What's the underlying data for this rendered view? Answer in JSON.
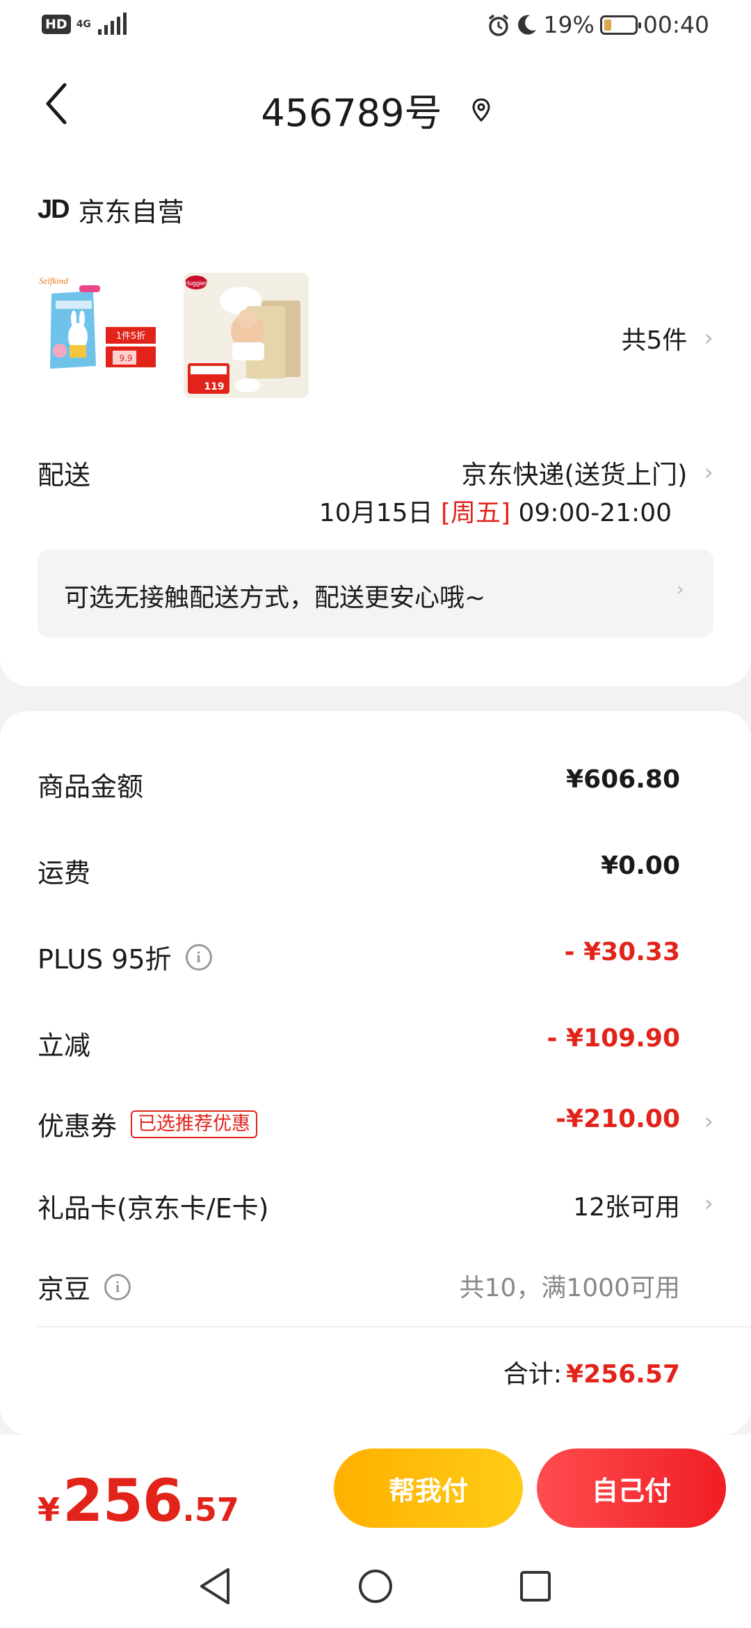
{
  "status_bar": {
    "hd": "HD",
    "network": "4G",
    "battery": "19%",
    "time": "00:40"
  },
  "nav": {
    "title": "456789号"
  },
  "shop": {
    "logo": "JD",
    "name": "京东自营"
  },
  "products": {
    "count_label": "共5件",
    "item1": {
      "tag": "1件5折",
      "price": "9.9"
    },
    "item2": {
      "price": "119"
    }
  },
  "delivery": {
    "label": "配送",
    "method": "京东快递(送货上门)",
    "date": "10月15日",
    "weekday": "[周五]",
    "time": "09:00-21:00",
    "notice": "可选无接触配送方式，配送更安心哦~"
  },
  "summary": {
    "rows": [
      {
        "label": "商品金额",
        "value": "¥606.80"
      },
      {
        "label": "运费",
        "value": "¥0.00"
      },
      {
        "label": "PLUS 95折",
        "value": "- ¥30.33"
      },
      {
        "label": "立减",
        "value": "- ¥109.90"
      },
      {
        "label": "优惠券",
        "tag": "已选推荐优惠",
        "value": "-¥210.00"
      },
      {
        "label": "礼品卡(京东卡/E卡)",
        "value": "12张可用"
      },
      {
        "label": "京豆",
        "value": "共10，满1000可用"
      }
    ],
    "total_label": "合计:",
    "total_value": "¥256.57"
  },
  "bottom": {
    "currency": "¥",
    "price_int": "256",
    "price_dec": ".57",
    "help_pay": "帮我付",
    "self_pay": "自己付"
  },
  "colors": {
    "accent_red": "#e2231a",
    "help_yellow": "#ffb000"
  }
}
